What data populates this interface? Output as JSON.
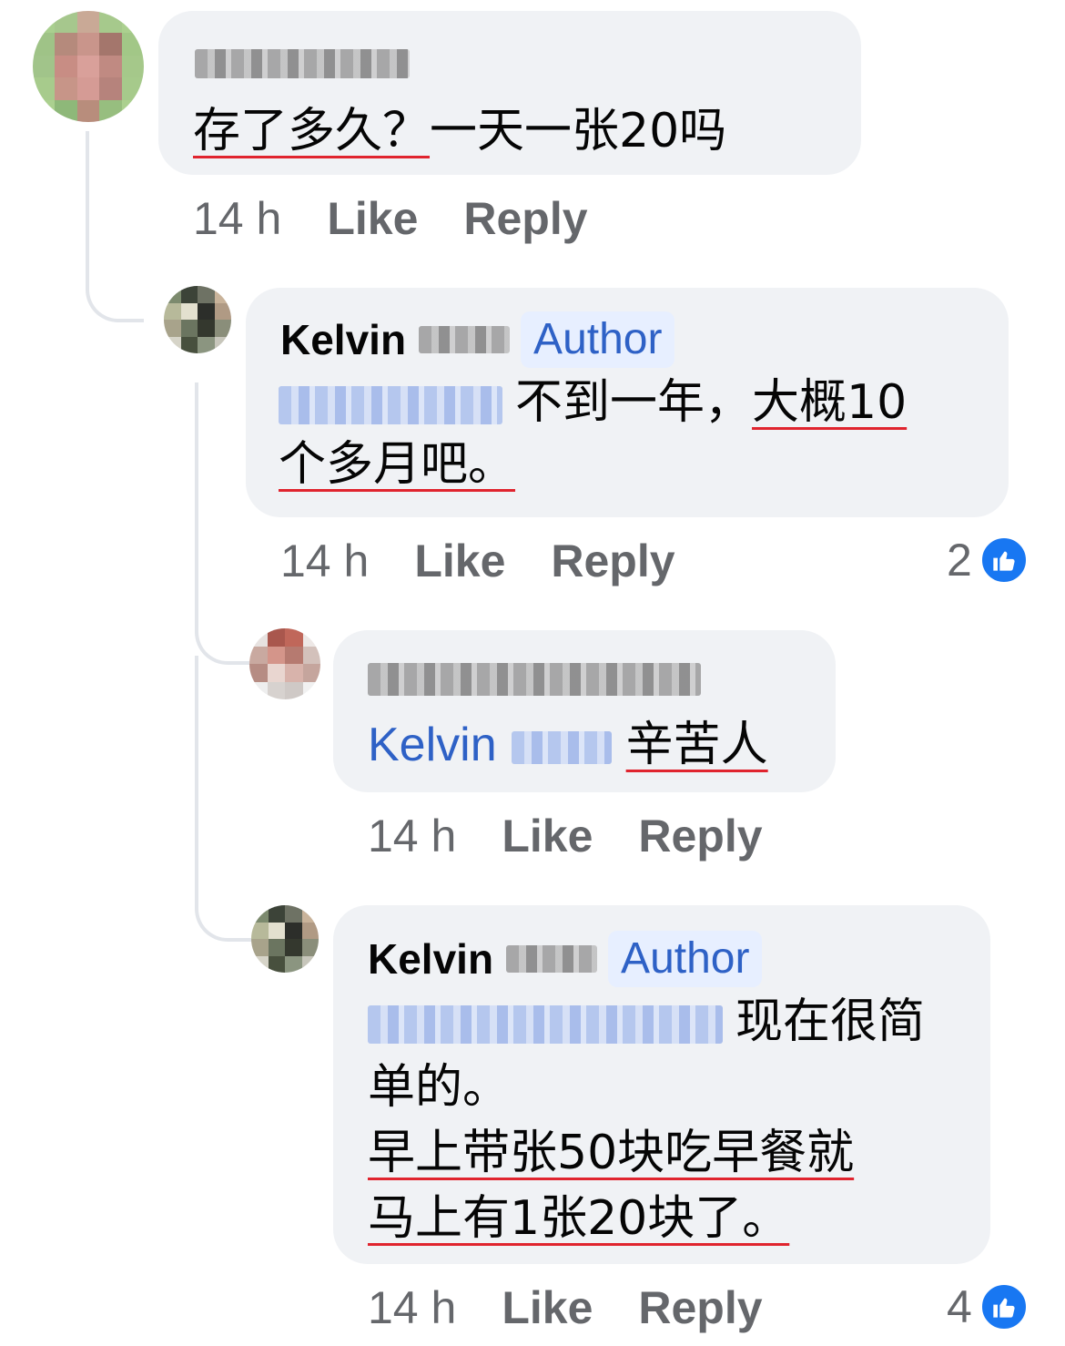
{
  "comments": [
    {
      "text_underlined": "存了多久？",
      "text_rest": "一天一张20吗",
      "time": "14 h",
      "like": "Like",
      "reply": "Reply"
    },
    {
      "author": "Kelvin",
      "badge": "Author",
      "text_plain": "不到一年，",
      "text_underlined_1": "大概10",
      "text_underlined_2": "个多月吧。",
      "time": "14 h",
      "like": "Like",
      "reply": "Reply",
      "reaction_count": "2"
    },
    {
      "mention": "Kelvin",
      "text_underlined": "辛苦人",
      "time": "14 h",
      "like": "Like",
      "reply": "Reply"
    },
    {
      "author": "Kelvin",
      "badge": "Author",
      "line1": "现在很简",
      "line2": "单的。",
      "line3": "早上带张50块吃早餐就",
      "line4": "马上有1张20块了。",
      "time": "14 h",
      "like": "Like",
      "reply": "Reply",
      "reaction_count": "4"
    }
  ],
  "colors": {
    "bubble": "#f0f2f5",
    "link": "#2e61c6",
    "like": "#1877f2",
    "underline": "#e0242e"
  },
  "icons": [
    "like-reaction-icon"
  ]
}
